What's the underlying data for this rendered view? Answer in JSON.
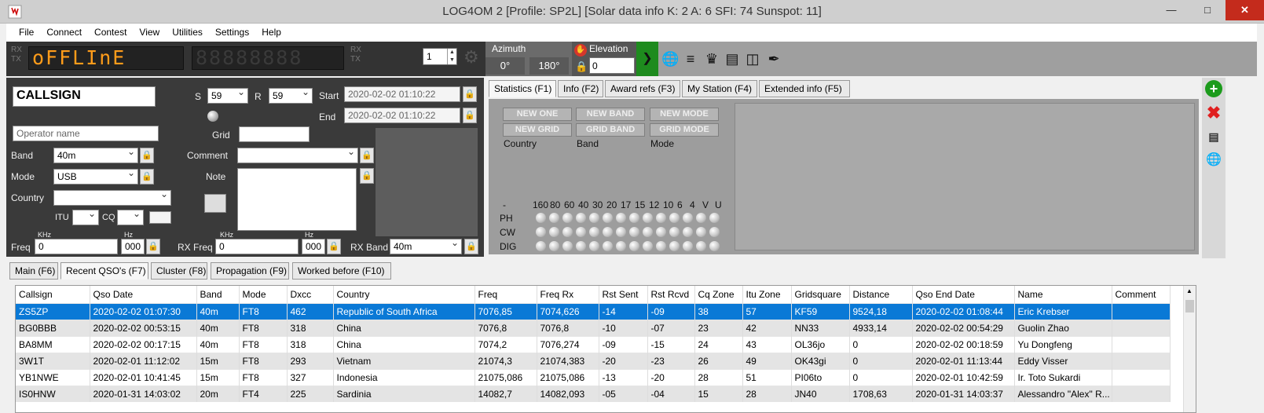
{
  "window": {
    "title": "LOG4OM 2 [Profile: SP2L] [Solar data info K: 2 A: 6 SFI: 74 Sunspot: 11]"
  },
  "menu": [
    "File",
    "Connect",
    "Contest",
    "View",
    "Utilities",
    "Settings",
    "Help"
  ],
  "toolbar": {
    "rx": "RX",
    "tx": "TX",
    "display1": "oFFLInE",
    "display2": "88888888",
    "display1_dim": "888",
    "spin_value": "1",
    "azimuth_label": "Azimuth",
    "az_left": "0°",
    "az_right": "180°",
    "elevation_label": "Elevation",
    "elevation_value": "0"
  },
  "entry": {
    "callsign_placeholder": "CALLSIGN",
    "s_label": "S",
    "s_value": "59",
    "r_label": "R",
    "r_value": "59",
    "start_label": "Start",
    "start_value": "2020-02-02 01:10:22",
    "end_label": "End",
    "end_value": "2020-02-02 01:10:22",
    "operator_placeholder": "Operator name",
    "grid_label": "Grid",
    "band_label": "Band",
    "band_value": "40m",
    "mode_label": "Mode",
    "mode_value": "USB",
    "comment_label": "Comment",
    "note_label": "Note",
    "country_label": "Country",
    "itu_label": "ITU",
    "cq_label": "CQ",
    "khz": "KHz",
    "hz": "Hz",
    "freq_label": "Freq",
    "freq_value": "0",
    "freq_hz": "000",
    "rxfreq_label": "RX Freq",
    "rxfreq_value": "0",
    "rxfreq_hz": "000",
    "rxband_label": "RX Band",
    "rxband_value": "40m"
  },
  "stats_tabs": [
    "Statistics (F1)",
    "Info (F2)",
    "Award refs (F3)",
    "My Station (F4)",
    "Extended info (F5)"
  ],
  "stats": {
    "new_one": "NEW ONE",
    "new_band": "NEW BAND",
    "new_mode": "NEW MODE",
    "new_grid": "NEW GRID",
    "grid_band": "GRID BAND",
    "grid_mode": "GRID MODE",
    "country": "Country",
    "band": "Band",
    "mode": "Mode",
    "bands_header": "-      160 80  60  40  30  20  17  15  12  10   6    4    V    U",
    "rows": [
      "PH",
      "CW",
      "DIG"
    ]
  },
  "bottom_tabs": [
    "Main (F6)",
    "Recent QSO's (F7)",
    "Cluster (F8)",
    "Propagation (F9)",
    "Worked before (F10)"
  ],
  "table": {
    "columns": [
      "Callsign",
      "Qso Date",
      "Band",
      "Mode",
      "Dxcc",
      "Country",
      "Freq",
      "Freq Rx",
      "Rst Sent",
      "Rst Rcvd",
      "Cq Zone",
      "Itu Zone",
      "Gridsquare",
      "Distance",
      "Qso End Date",
      "Name",
      "Comment"
    ],
    "rows": [
      [
        "ZS5ZP",
        "2020-02-02 01:07:30",
        "40m",
        "FT8",
        "462",
        "Republic of South Africa",
        "7076,85",
        "7074,626",
        "-14",
        "-09",
        "38",
        "57",
        "KF59",
        "9524,18",
        "2020-02-02 01:08:44",
        "Eric Krebser",
        ""
      ],
      [
        "BG0BBB",
        "2020-02-02 00:53:15",
        "40m",
        "FT8",
        "318",
        "China",
        "7076,8",
        "7076,8",
        "-10",
        "-07",
        "23",
        "42",
        "NN33",
        "4933,14",
        "2020-02-02 00:54:29",
        "Guolin Zhao",
        ""
      ],
      [
        "BA8MM",
        "2020-02-02 00:17:15",
        "40m",
        "FT8",
        "318",
        "China",
        "7074,2",
        "7076,274",
        "-09",
        "-15",
        "24",
        "43",
        "OL36jo",
        "0",
        "2020-02-02 00:18:59",
        "Yu Dongfeng",
        ""
      ],
      [
        "3W1T",
        "2020-02-01 11:12:02",
        "15m",
        "FT8",
        "293",
        "Vietnam",
        "21074,3",
        "21074,383",
        "-20",
        "-23",
        "26",
        "49",
        "OK43gi",
        "0",
        "2020-02-01 11:13:44",
        "Eddy Visser",
        ""
      ],
      [
        "YB1NWE",
        "2020-02-01 10:41:45",
        "15m",
        "FT8",
        "327",
        "Indonesia",
        "21075,086",
        "21075,086",
        "-13",
        "-20",
        "28",
        "51",
        "PI06to",
        "0",
        "2020-02-01 10:42:59",
        "Ir. Toto Sukardi",
        ""
      ],
      [
        "IS0HNW",
        "2020-01-31 14:03:02",
        "20m",
        "FT4",
        "225",
        "Sardinia",
        "14082,7",
        "14082,093",
        "-05",
        "-04",
        "15",
        "28",
        "JN40",
        "1708,63",
        "2020-01-31 14:03:37",
        "Alessandro \"Alex\" R...",
        ""
      ]
    ]
  }
}
